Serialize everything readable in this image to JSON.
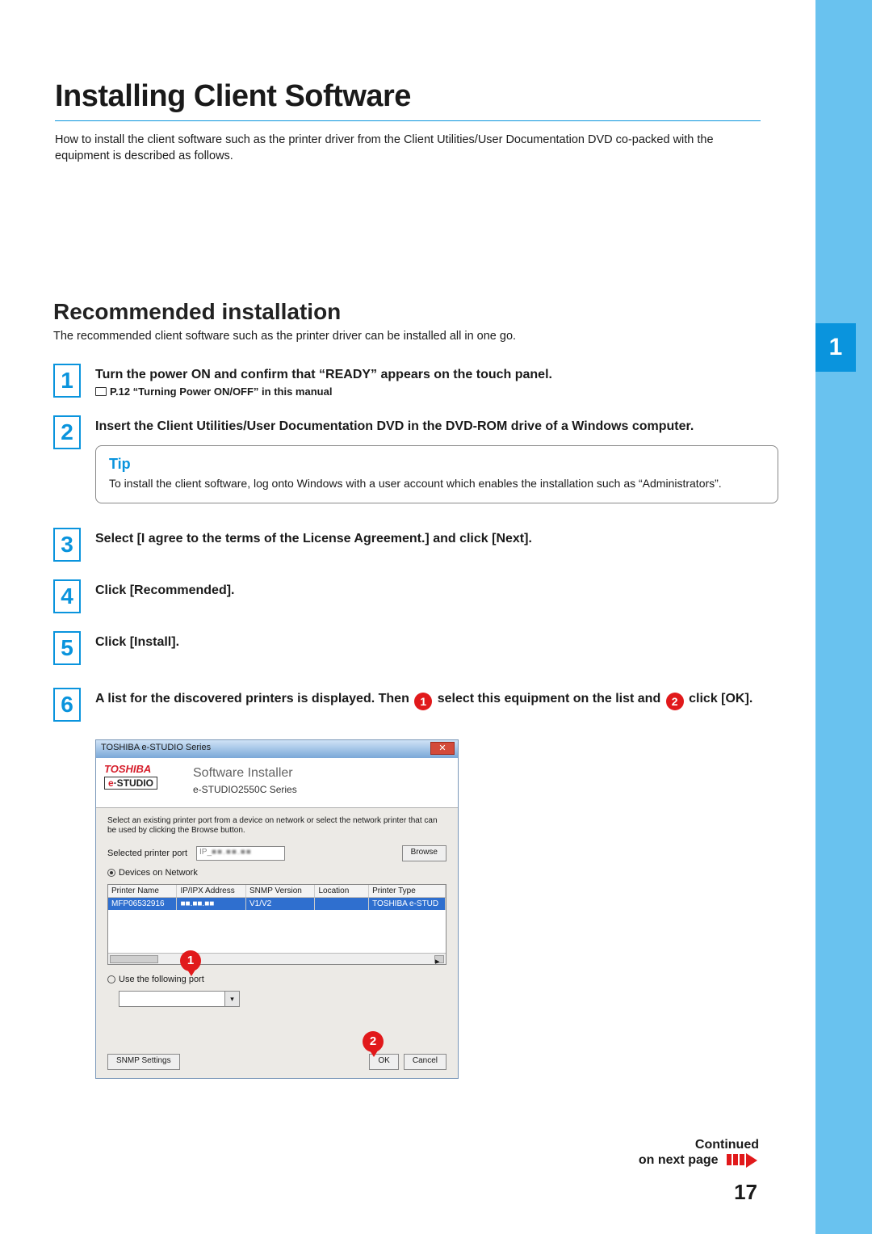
{
  "header": {
    "running_head": "Installing Client Software",
    "title": "Installing Client Software",
    "intro": "How to install the client software such as the printer driver from the Client Utilities/User Documentation DVD co-packed with the equipment is described as follows."
  },
  "chapter_tab": "1",
  "section": {
    "title": "Recommended installation",
    "lead": "The recommended client software such as the printer driver can be installed all in one go."
  },
  "steps": {
    "s1": {
      "num": "1",
      "text": "Turn the power ON and confirm that “READY” appears on the touch panel.",
      "ref": "P.12 “Turning Power ON/OFF” in this manual"
    },
    "s2": {
      "num": "2",
      "text": "Insert the Client Utilities/User Documentation DVD in the DVD-ROM drive of a Windows computer."
    },
    "tip": {
      "title": "Tip",
      "text": "To install the client software, log onto Windows with a user account which enables the installation such as “Administrators”."
    },
    "s3": {
      "num": "3",
      "text": "Select [I agree to the terms of the License Agreement.] and click [Next]."
    },
    "s4": {
      "num": "4",
      "text": "Click [Recommended]."
    },
    "s5": {
      "num": "5",
      "text": "Click [Install]."
    },
    "s6": {
      "num": "6",
      "text_a": "A list for the discovered printers is displayed. Then ",
      "badge1": "1",
      "text_b": " select this equipment on the list and ",
      "badge2": "2",
      "text_c": " click [OK]."
    }
  },
  "installer": {
    "titlebar": "TOSHIBA e-STUDIO Series",
    "close": "✕",
    "brand": "TOSHIBA",
    "estudio_e": "e",
    "estudio_rest": "·STUDIO",
    "htitle": "Software Installer",
    "hseries": "e-STUDIO2550C Series",
    "desc": "Select an existing printer port from a device on network or select the network printer that can be used by clicking the Browse button.",
    "selected_port_label": "Selected printer port",
    "ip_prefix": "IP_",
    "browse": "Browse",
    "devices_label": "Devices on Network",
    "cols": {
      "c1": "Printer Name",
      "c2": "IP/IPX Address",
      "c3": "SNMP Version",
      "c4": "Location",
      "c5": "Printer Type"
    },
    "row": {
      "c1": "MFP06532916",
      "c3": "V1/V2",
      "c4": "",
      "c5": "TOSHIBA e-STUD"
    },
    "use_port_label": "Use the following port",
    "snmp_btn": "SNMP Settings",
    "ok_btn": "OK",
    "cancel_btn": "Cancel",
    "callout1": "1",
    "callout2": "2"
  },
  "footer": {
    "continued_a": "Continued",
    "continued_b": "on next page",
    "page_num": "17"
  }
}
